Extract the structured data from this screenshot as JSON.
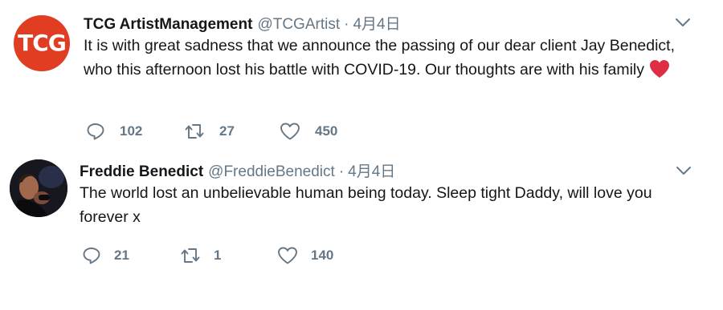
{
  "tweets": [
    {
      "display_name": "TCG ArtistManagement",
      "handle": "@TCGArtist",
      "separator": "·",
      "date": "4月4日",
      "avatar_label": "TCG",
      "text": "It is with great sadness that we announce the passing of our dear client Jay Benedict, who this afternoon lost his battle with COVID-19. Our thoughts are with his family",
      "emoji": "red-heart",
      "replies": "102",
      "retweets": "27",
      "likes": "450"
    },
    {
      "display_name": "Freddie Benedict",
      "handle": "@FreddieBenedict",
      "separator": "·",
      "date": "4月4日",
      "text": "The world lost an unbelievable human being today. Sleep tight Daddy, will love you forever x",
      "replies": "21",
      "retweets": "1",
      "likes": "140"
    }
  ],
  "icons": {
    "reply": "comment-bubble-icon",
    "retweet": "retweet-arrows-icon",
    "like": "heart-outline-icon",
    "more": "chevron-down-icon"
  },
  "colors": {
    "brand_red": "#e03d22",
    "secondary_text": "#657786",
    "heart": "#e0245e"
  }
}
